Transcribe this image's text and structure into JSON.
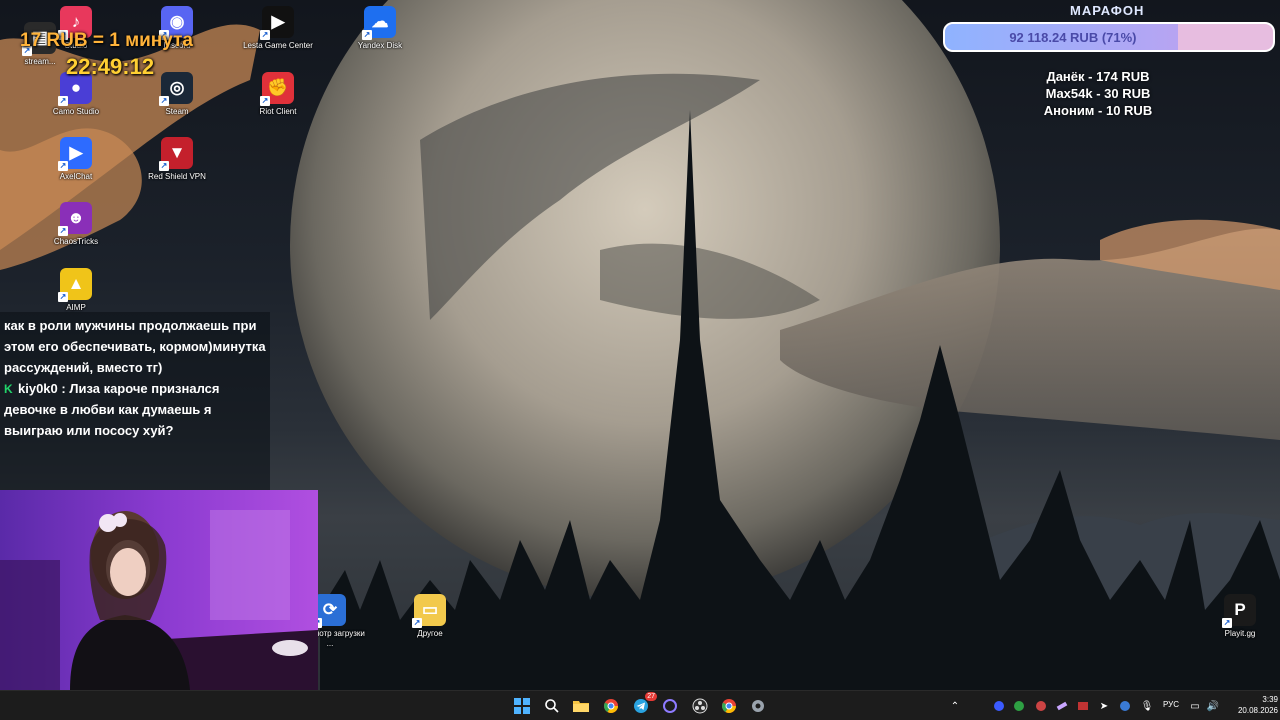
{
  "overlay": {
    "rate": "17 RUB = 1 минута",
    "clock": "22:49:12",
    "marathon": {
      "title": "МАРАФОН",
      "amount_label": "92 118.24 RUB (71%)",
      "progress_percent": 71,
      "donors": [
        "Данёк - 174 RUB",
        "Max54k - 30 RUB",
        "Аноним - 10 RUB"
      ]
    },
    "chat": [
      {
        "user": "",
        "text": "как в роли мужчины продолжаешь при этом его обеспечивать, кормом)минутка рассуждений, вместо тг)"
      },
      {
        "user": "kiy0k0",
        "sep": " : ",
        "text": "Лиза кароче признался девочке в любви как думаешь я выиграю или пососу хуй?"
      }
    ]
  },
  "desktop_icons": [
    {
      "label": "stream...",
      "color": "#2a2a2a",
      "icon": "stream-icon"
    },
    {
      "label": "Studio",
      "color": "#e8385c",
      "icon": "tiktok-studio-icon"
    },
    {
      "label": "Discord",
      "color": "#5865f2",
      "icon": "discord-icon"
    },
    {
      "label": "Lesta Game Center",
      "color": "#111111",
      "icon": "lesta-icon"
    },
    {
      "label": "Yandex Disk",
      "color": "#1e6ff0",
      "icon": "yandex-disk-icon"
    },
    {
      "label": "Camo Studio",
      "color": "#4a3ed6",
      "icon": "camo-icon"
    },
    {
      "label": "Steam",
      "color": "#1b2838",
      "icon": "steam-icon"
    },
    {
      "label": "Riot Client",
      "color": "#e0313a",
      "icon": "riot-icon"
    },
    {
      "label": "AxelChat",
      "color": "#2d6bff",
      "icon": "axelchat-icon"
    },
    {
      "label": "Red Shield VPN",
      "color": "#c4202c",
      "icon": "red-shield-icon"
    },
    {
      "label": "ChaosTricks",
      "color": "#8a2fb8",
      "icon": "chaostricks-icon"
    },
    {
      "label": "AIMP",
      "color": "#f0c419",
      "icon": "aimp-icon"
    },
    {
      "label": "Просмотр загрузки ...",
      "color": "#2b6fd6",
      "icon": "downloads-icon"
    },
    {
      "label": "Другое",
      "color": "#f2c94c",
      "icon": "folder-icon"
    },
    {
      "label": "Playit.gg",
      "color": "#1a1a1a",
      "icon": "playit-icon"
    }
  ],
  "taskbar": {
    "apps": [
      "start-icon",
      "search-icon",
      "explorer-icon",
      "chrome-icon",
      "telegram-icon",
      "cortana-icon",
      "obs-icon",
      "chrome-icon-2",
      "settings-icon"
    ],
    "telegram_badge": "27",
    "language": "РУС",
    "time": "3:39",
    "date": "20.08.2026"
  },
  "colors": {
    "rate": "#ffb33a",
    "clock": "#ffcf33",
    "bar_fill": "#8fb3ff",
    "bar_bg": "#e7bde0",
    "taskbar": "#1c1c1c"
  }
}
